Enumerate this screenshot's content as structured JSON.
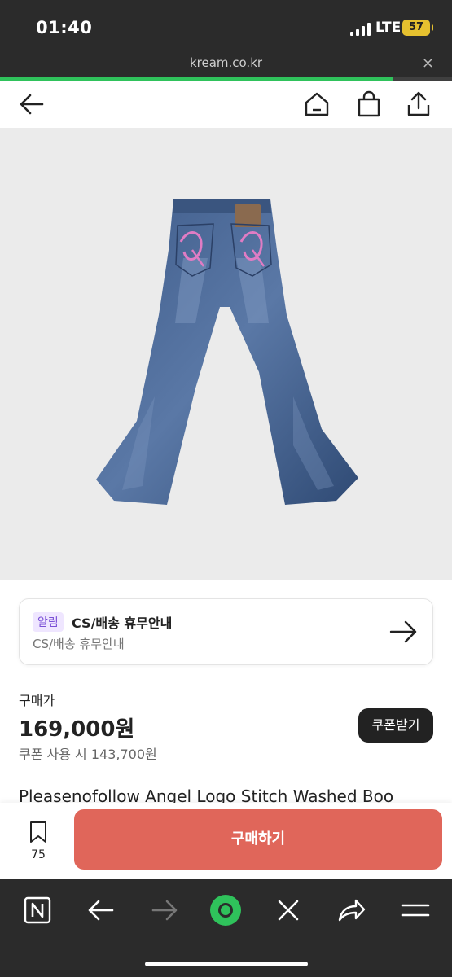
{
  "status_bar": {
    "time": "01:40",
    "network": "LTE",
    "battery": "57"
  },
  "browser": {
    "url": "kream.co.kr",
    "close_label": "×",
    "load_progress": 0.87
  },
  "header": {
    "back_icon": "arrow-left-icon",
    "home_icon": "home-icon",
    "shop_icon": "shopping-bag-icon",
    "share_icon": "share-icon"
  },
  "notice": {
    "badge": "알림",
    "title": "CS/배송 휴무안내",
    "subtitle": "CS/배송 휴무안내",
    "arrow_icon": "arrow-right-icon"
  },
  "price": {
    "label": "구매가",
    "value": "169,000원",
    "coupon_price": "쿠폰 사용 시 143,700원",
    "coupon_button": "쿠폰받기"
  },
  "product": {
    "title": "Pleasenofollow Angel Logo Stitch Washed Boo"
  },
  "buy_bar": {
    "bookmark_count": "75",
    "buy_label": "구매하기"
  },
  "colors": {
    "accent": "#e0665a",
    "progress": "#2fc25b",
    "dark": "#2b2b2b"
  }
}
